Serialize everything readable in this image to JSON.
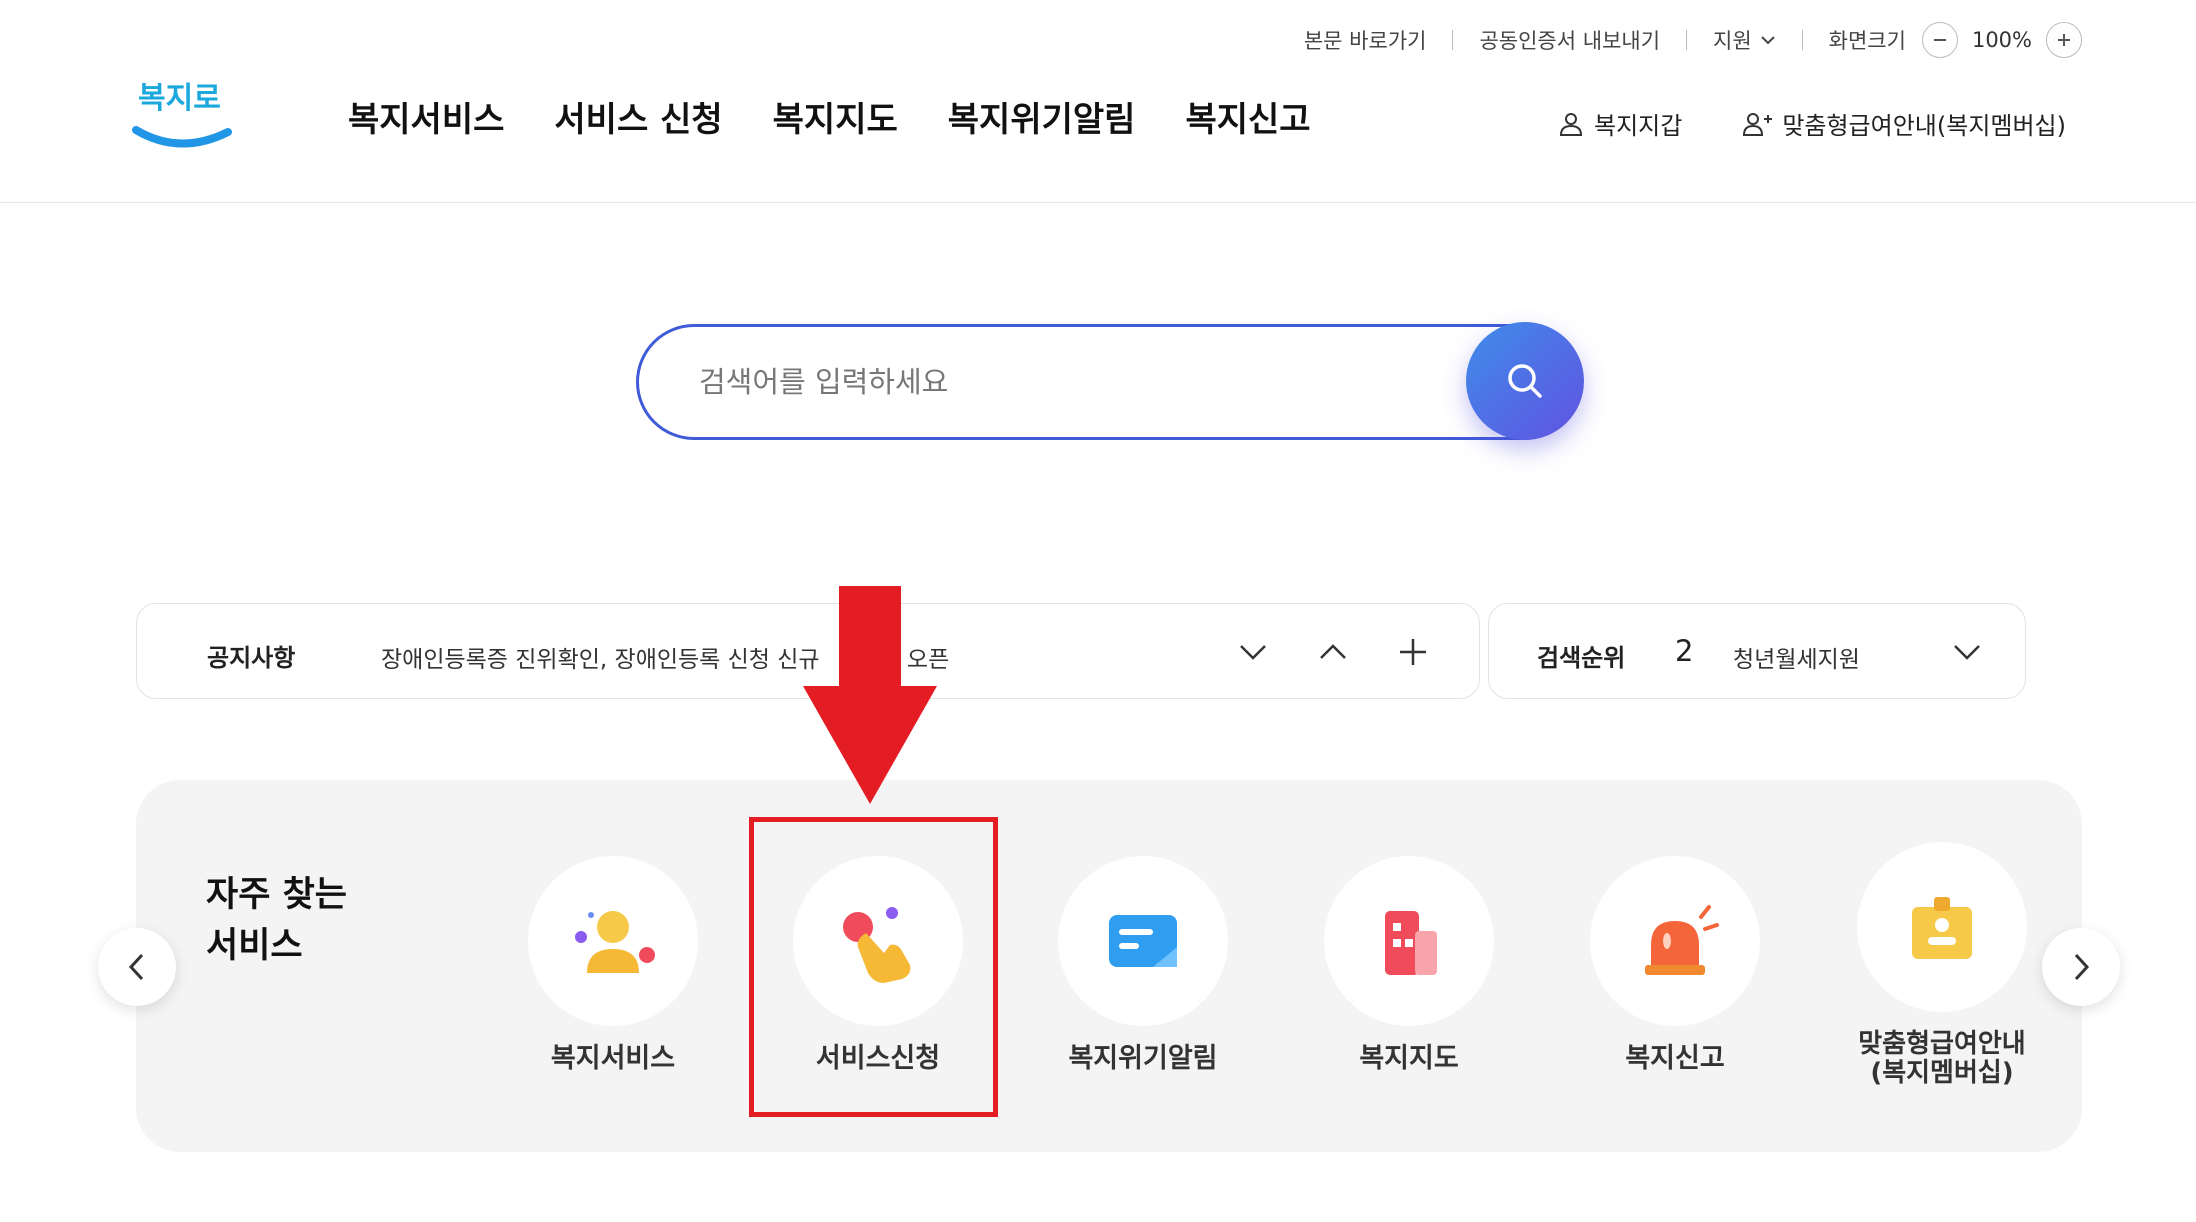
{
  "utility": {
    "skip": "본문 바로가기",
    "cert": "공동인증서 내보내기",
    "support": "지원",
    "screen_size": "화면크기",
    "zoom": "100%"
  },
  "logo": {
    "text": "복지로"
  },
  "gnb": [
    "복지서비스",
    "서비스 신청",
    "복지지도",
    "복지위기알림",
    "복지신고"
  ],
  "header_right": {
    "wallet": "복지지갑",
    "membership": "맞춤형급여안내(복지멤버십)"
  },
  "search": {
    "placeholder": "검색어를 입력하세요"
  },
  "notice": {
    "label": "공지사항",
    "text": "장애인등록증 진위확인, 장애인등록 신청 신규",
    "text_tail": "오픈"
  },
  "rank": {
    "label": "검색순위",
    "num": "2",
    "keyword": "청년월세지원"
  },
  "freq": {
    "title_line1": "자주 찾는",
    "title_line2": "서비스",
    "items": [
      {
        "label": "복지서비스"
      },
      {
        "label": "서비스신청"
      },
      {
        "label": "복지위기알림"
      },
      {
        "label": "복지지도"
      },
      {
        "label": "복지신고"
      },
      {
        "label_line1": "맞춤형급여안내",
        "label_line2": "(복지멤버십)"
      }
    ]
  },
  "colors": {
    "accent": "#3f5bd8",
    "annotation": "#e41c23",
    "panel_bg": "#f4f4f5"
  }
}
